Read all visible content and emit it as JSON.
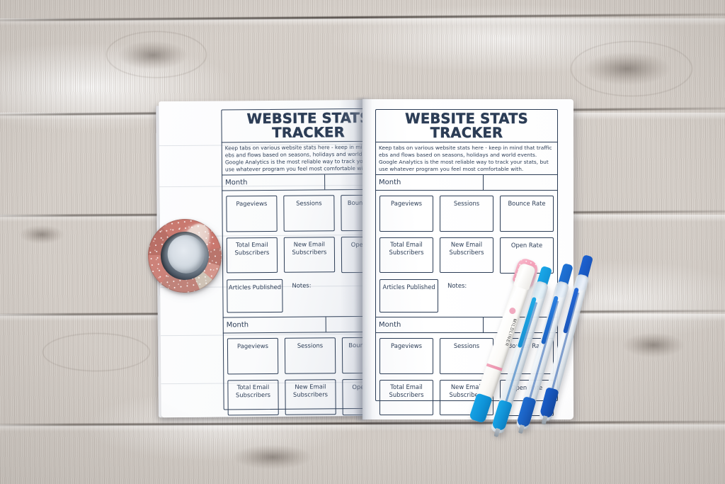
{
  "scene": {
    "surface": "whitewashed-wood-planks",
    "surface_color": "#d6d0ca",
    "ink_color": "#2c3d56",
    "paper_color": "#ffffff"
  },
  "printable": {
    "title": "WEBSITE STATS TRACKER",
    "blurb_lines": [
      "Keep tabs on various website stats here - keep in mind that traffic",
      "ebs and flows based on seasons, holidays and world events.",
      "Google Analytics is the most reliable way to track your stats, but",
      "use whatever program you feel most comfortable with."
    ],
    "month_label": "Month",
    "notes_label": "Notes:",
    "rows": [
      [
        "Pageviews",
        "Sessions",
        "Bounce Rate"
      ],
      [
        "Total Email\nSubscribers",
        "New Email\nSubscribers",
        "Open Rate"
      ]
    ],
    "metrics": {
      "pageviews": "Pageviews",
      "sessions": "Sessions",
      "bounce_rate": "Bounce Rate",
      "total_email_subscribers_l1": "Total Email",
      "total_email_subscribers_l2": "Subscribers",
      "new_email_subscribers_l1": "New Email",
      "new_email_subscribers_l2": "Subscribers",
      "open_rate": "Open Rate",
      "articles_published": "Articles Published"
    },
    "sections_per_page": 2
  },
  "objects": {
    "notebook": "open-spiral-less-notebook-two-pages",
    "washi_tape": {
      "name": "washi-tape-roll",
      "color": "#c9796f",
      "accent_color": "#f2ece4",
      "core_color": "#2b3440"
    },
    "pens": [
      {
        "name": "mildliner-highlighter",
        "barrel_color": "#f7f6f3",
        "accent_color": "#f0a9bf",
        "grip_color": "#17a6e8",
        "brand_text": "MILDLINER"
      },
      {
        "name": "gel-pen-cyan",
        "grip_color": "#19a9ea",
        "cap_color": "#1aa9ea"
      },
      {
        "name": "gel-pen-blue",
        "grip_color": "#1f6fd4",
        "cap_color": "#1f74d8"
      },
      {
        "name": "gel-pen-royal-blue",
        "grip_color": "#1a5fcc",
        "cap_color": "#1c62d2"
      }
    ]
  }
}
